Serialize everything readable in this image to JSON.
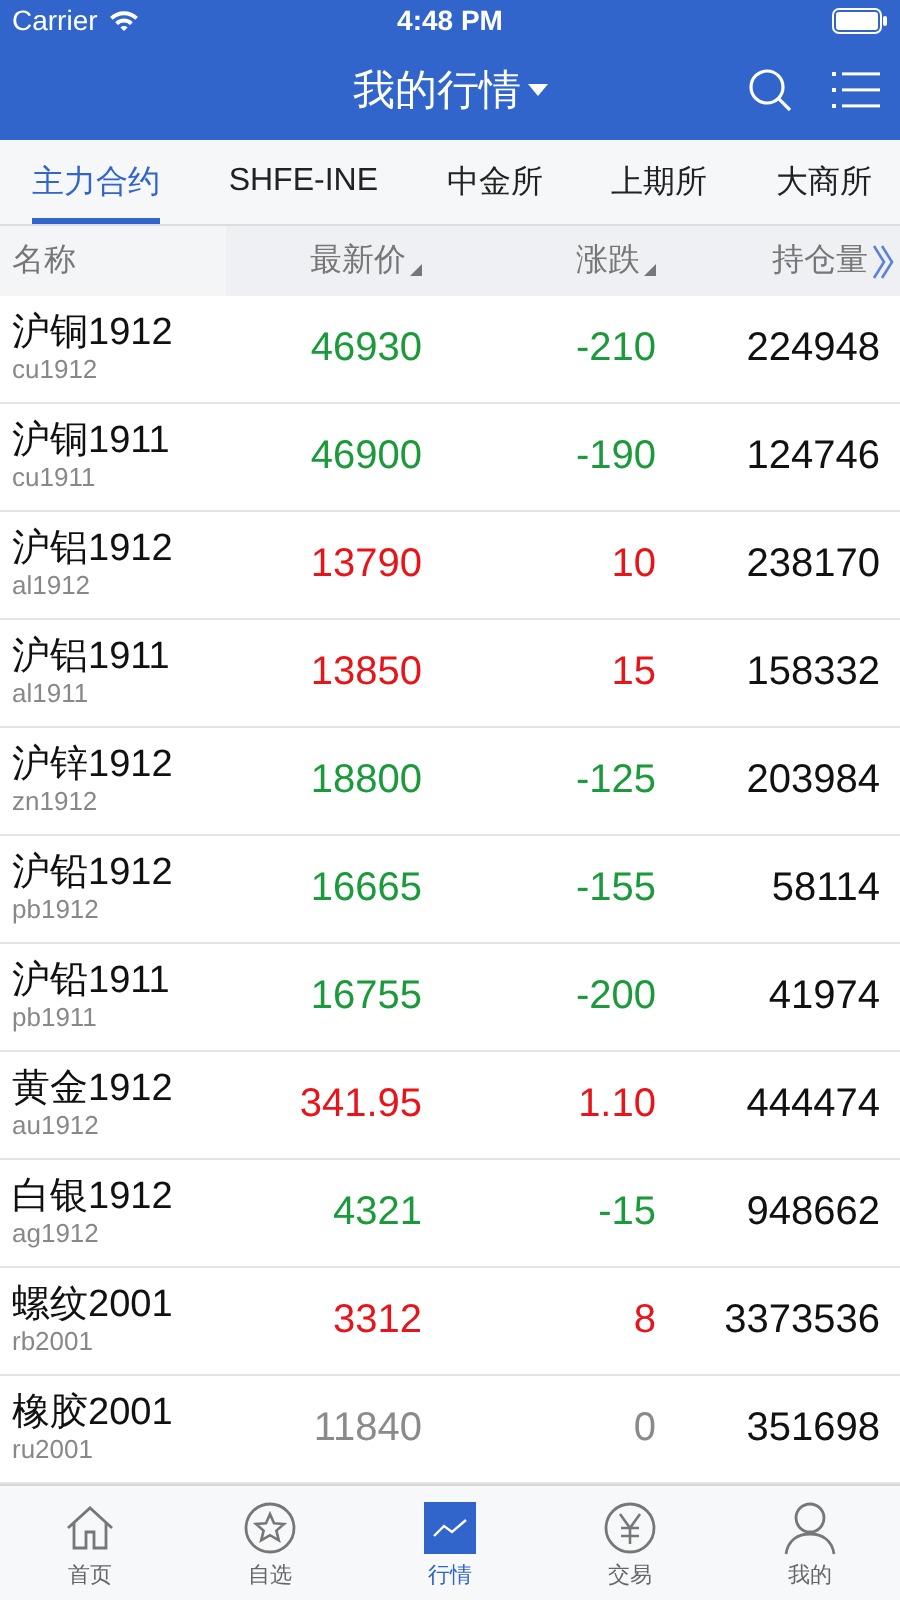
{
  "status_bar": {
    "carrier": "Carrier",
    "time": "4:48 PM"
  },
  "nav": {
    "title": "我的行情"
  },
  "tabs": [
    {
      "label": "主力合约",
      "selected": true
    },
    {
      "label": "SHFE-INE",
      "selected": false
    },
    {
      "label": "中金所",
      "selected": false
    },
    {
      "label": "上期所",
      "selected": false
    },
    {
      "label": "大商所",
      "selected": false
    }
  ],
  "columns": [
    "名称",
    "最新价",
    "涨跌",
    "持仓量"
  ],
  "rows": [
    {
      "name": "沪铜1912",
      "code": "cu1912",
      "price": "46930",
      "change": "-210",
      "open_interest": "224948",
      "kind": "down"
    },
    {
      "name": "沪铜1911",
      "code": "cu1911",
      "price": "46900",
      "change": "-190",
      "open_interest": "124746",
      "kind": "down"
    },
    {
      "name": "沪铝1912",
      "code": "al1912",
      "price": "13790",
      "change": "10",
      "open_interest": "238170",
      "kind": "up"
    },
    {
      "name": "沪铝1911",
      "code": "al1911",
      "price": "13850",
      "change": "15",
      "open_interest": "158332",
      "kind": "up"
    },
    {
      "name": "沪锌1912",
      "code": "zn1912",
      "price": "18800",
      "change": "-125",
      "open_interest": "203984",
      "kind": "down"
    },
    {
      "name": "沪铅1912",
      "code": "pb1912",
      "price": "16665",
      "change": "-155",
      "open_interest": "58114",
      "kind": "down"
    },
    {
      "name": "沪铅1911",
      "code": "pb1911",
      "price": "16755",
      "change": "-200",
      "open_interest": "41974",
      "kind": "down"
    },
    {
      "name": "黄金1912",
      "code": "au1912",
      "price": "341.95",
      "change": "1.10",
      "open_interest": "444474",
      "kind": "up"
    },
    {
      "name": "白银1912",
      "code": "ag1912",
      "price": "4321",
      "change": "-15",
      "open_interest": "948662",
      "kind": "down"
    },
    {
      "name": "螺纹2001",
      "code": "rb2001",
      "price": "3312",
      "change": "8",
      "open_interest": "3373536",
      "kind": "up"
    },
    {
      "name": "橡胶2001",
      "code": "ru2001",
      "price": "11840",
      "change": "0",
      "open_interest": "351698",
      "kind": "flat"
    }
  ],
  "bottom_tabs": [
    {
      "label": "首页",
      "kind": "home",
      "selected": false
    },
    {
      "label": "自选",
      "kind": "star",
      "selected": false
    },
    {
      "label": "行情",
      "kind": "chart",
      "selected": true
    },
    {
      "label": "交易",
      "kind": "yen",
      "selected": false
    },
    {
      "label": "我的",
      "kind": "person",
      "selected": false
    }
  ]
}
